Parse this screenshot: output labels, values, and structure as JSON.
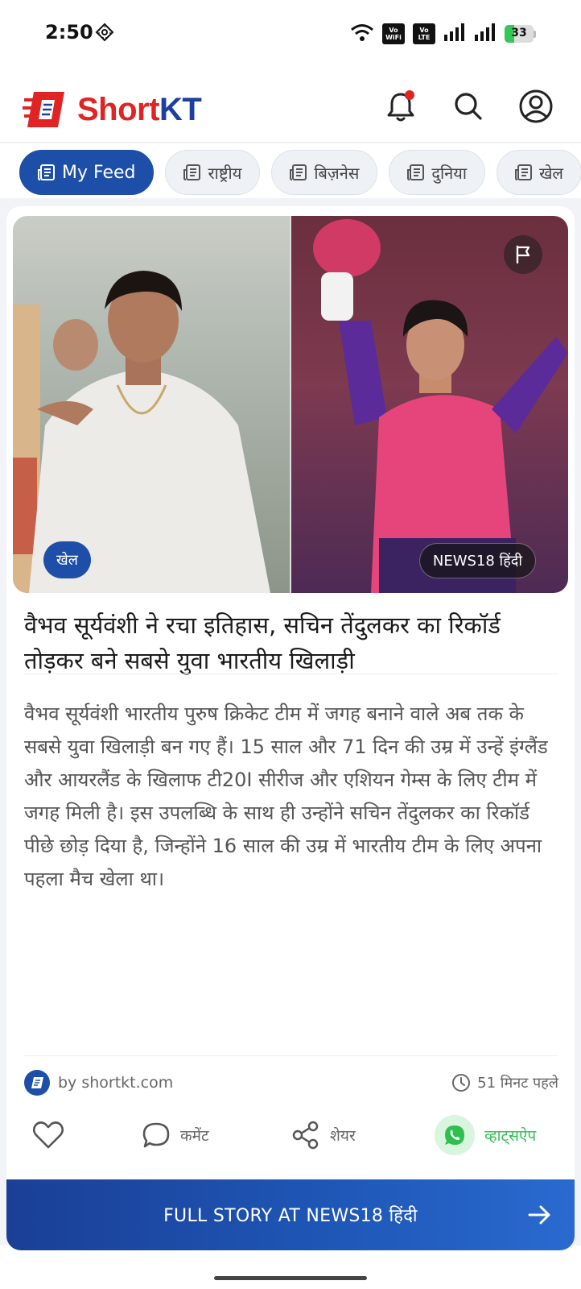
{
  "status_bar": {
    "time": "2:50",
    "sim1": [
      "Vo",
      "WiFi"
    ],
    "sim2": [
      "Vo",
      "LTE"
    ],
    "battery_level": 33,
    "battery_text": "33"
  },
  "header": {
    "logo_short": "Short",
    "logo_kt": "KT",
    "colors": {
      "red": "#e02424",
      "blue": "#1d3f9e"
    }
  },
  "tabs": [
    {
      "label": "My Feed",
      "active": true
    },
    {
      "label": "राष्ट्रीय",
      "active": false
    },
    {
      "label": "बिज़नेस",
      "active": false
    },
    {
      "label": "दुनिया",
      "active": false
    },
    {
      "label": "खेल",
      "active": false
    }
  ],
  "article": {
    "category": "खेल",
    "source_badge": "NEWS18 हिंदी",
    "headline": "वैभव सूर्यवंशी ने रचा इतिहास, सचिन तेंदुलकर का रिकॉर्ड तोड़कर बने सबसे युवा भारतीय खिलाड़ी",
    "summary": "वैभव सूर्यवंशी भारतीय पुरुष क्रिकेट टीम में जगह बनाने वाले अब तक के सबसे युवा खिलाड़ी बन गए हैं। 15 साल और 71 दिन की उम्र में उन्हें इंग्लैंड और आयरलैंड के खिलाफ टी20I सीरीज और एशियन गेम्स के लिए टीम में जगह मिली है। इस उपलब्धि के साथ ही उन्होंने सचिन तेंदुलकर का रिकॉर्ड पीछे छोड़ दिया है, जिन्होंने 16 साल की उम्र में भारतीय टीम के लिए अपना पहला मैच खेला था।",
    "source_name": "by shortkt.com",
    "time_ago": "51 मिनट पहले"
  },
  "actions": {
    "comment": "कमेंट",
    "share": "शेयर",
    "whatsapp": "व्हाट्सऐप"
  },
  "cta": {
    "label": "FULL STORY AT NEWS18 हिंदी"
  }
}
